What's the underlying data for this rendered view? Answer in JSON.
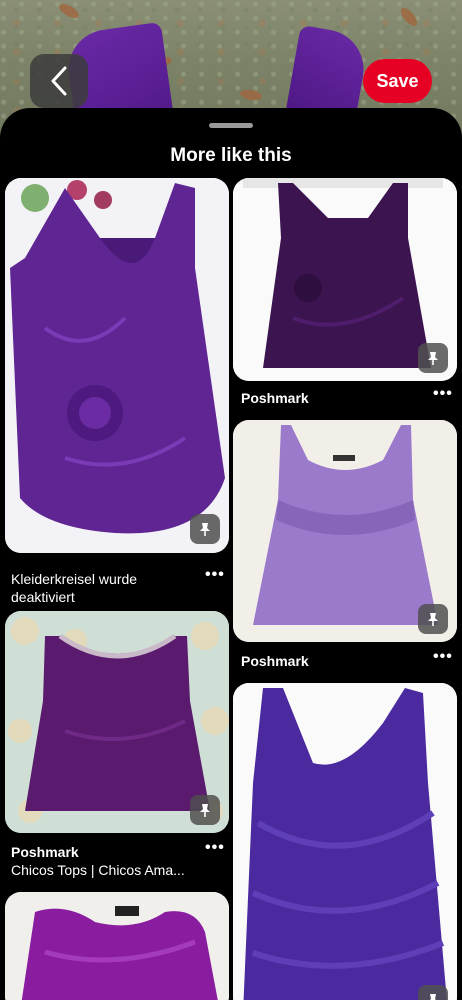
{
  "header": {
    "save_label": "Save"
  },
  "sheet": {
    "title": "More like this"
  },
  "pins": [
    {
      "source": "",
      "description": "Kleiderkreisel wurde deaktiviert",
      "more": "•••"
    },
    {
      "source": "Poshmark",
      "description": "",
      "more": "•••"
    },
    {
      "source": "Poshmark",
      "description": "",
      "more": "•••"
    },
    {
      "source": "Poshmark",
      "description": "Chicos Tops | Chicos Ama...",
      "more": "•••"
    },
    {
      "source": "",
      "description": "",
      "more": ""
    },
    {
      "source": "",
      "description": "",
      "more": ""
    }
  ],
  "colors": {
    "save": "#e60023",
    "shirt_purple": "#5b1f92"
  },
  "icons": {
    "back": "chevron-left-icon",
    "pin": "pin-icon"
  }
}
